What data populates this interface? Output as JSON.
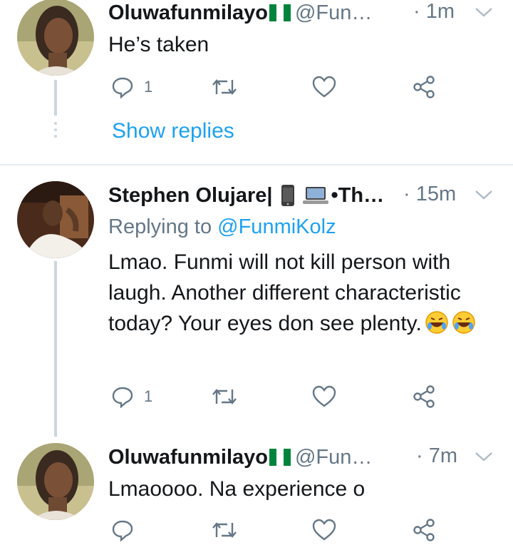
{
  "tweets": [
    {
      "name": "Oluwafunmilayo",
      "handle": "@Fun…",
      "time": "· 1m",
      "text": "He’s taken",
      "reply_count": "1",
      "show_replies": "Show replies"
    },
    {
      "name": "Stephen Olujare|",
      "name_suffix": "•Th…",
      "time": "· 15m",
      "replying_prefix": "Replying to",
      "replying_mention": "@FunmiKolz",
      "text": "Lmao. Funmi will not kill person with laugh. Another different characteristic today? Your eyes don see plenty.",
      "reply_count": "1"
    },
    {
      "name": "Oluwafunmilayo",
      "handle": "@Fun…",
      "time": "· 7m",
      "text": "Lmaoooo. Na experience o"
    }
  ],
  "icons": [
    "reply-icon",
    "retweet-icon",
    "like-icon",
    "share-icon",
    "chevron-down-icon",
    "nigeria-flag-icon",
    "phone-emoji-icon",
    "laptop-emoji-icon",
    "rofl-emoji-icon"
  ],
  "colors": {
    "link": "#1da1f2",
    "muted": "#657786",
    "thread_line": "#ccd6dd",
    "text": "#14171a"
  }
}
